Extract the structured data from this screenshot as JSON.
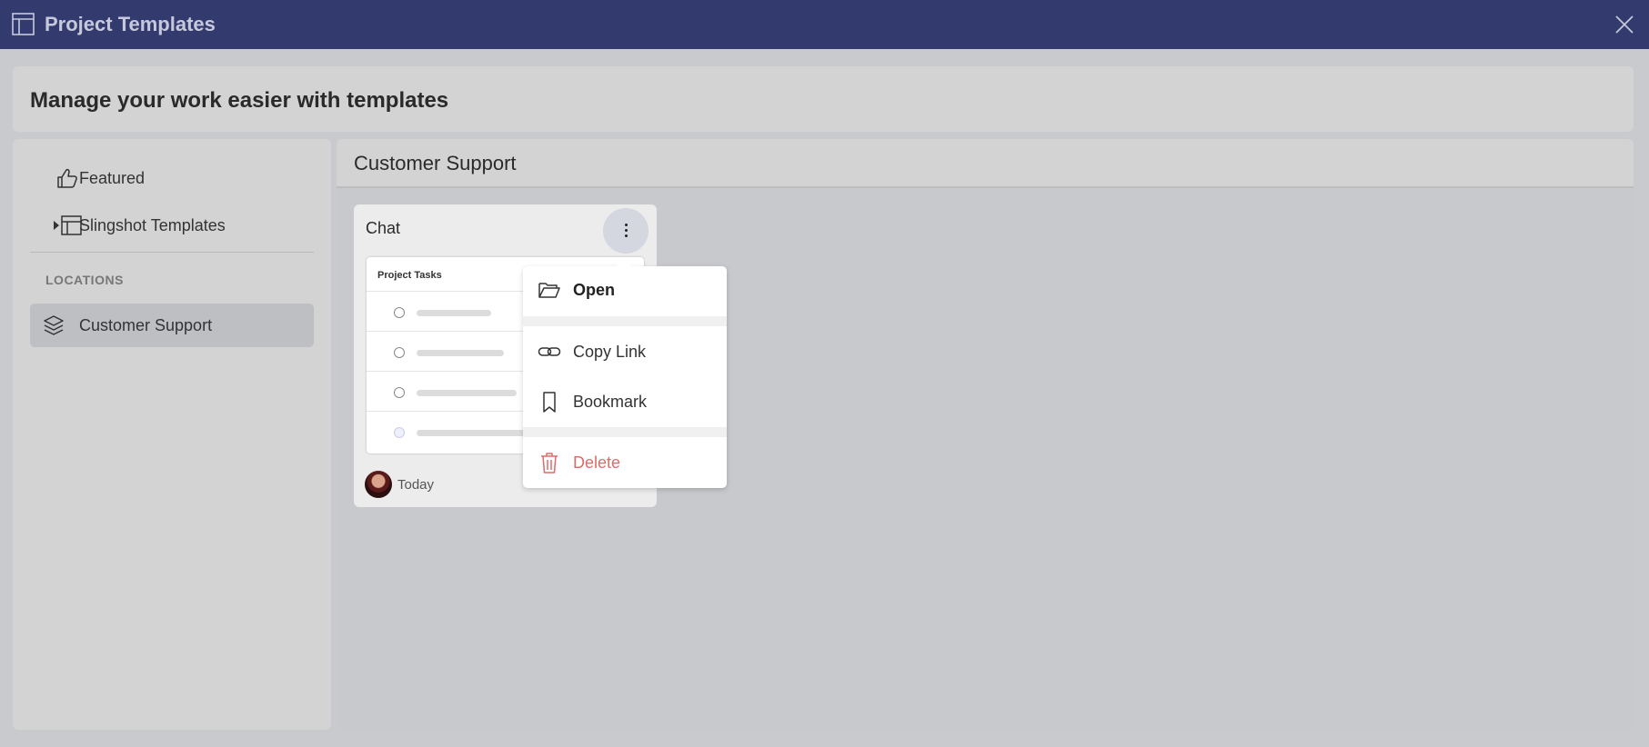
{
  "window": {
    "title": "Project Templates",
    "app_icon": "template-icon",
    "close_icon": "close-icon"
  },
  "banner": {
    "text": "Manage your work easier with templates"
  },
  "sidebar": {
    "items": [
      {
        "label": "Featured",
        "icon": "thumbs-up-icon"
      },
      {
        "label": "Slingshot Templates",
        "icon": "template-icon",
        "expandable": true
      }
    ],
    "locations_label": "LOCATIONS",
    "locations": [
      {
        "label": "Customer Support",
        "icon": "layers-icon",
        "selected": true
      }
    ]
  },
  "main": {
    "title": "Customer Support",
    "cards": [
      {
        "title": "Chat",
        "preview_title": "Project Tasks",
        "date": "Today",
        "menu_icon": "more-vertical-icon"
      }
    ]
  },
  "context_menu": {
    "items": [
      {
        "label": "Open",
        "icon": "folder-open-icon"
      },
      {
        "label": "Copy Link",
        "icon": "link-icon"
      },
      {
        "label": "Bookmark",
        "icon": "bookmark-icon"
      },
      {
        "label": "Delete",
        "icon": "trash-icon",
        "color": "#e06a6a"
      }
    ]
  },
  "colors": {
    "titlebar": "#333b6e",
    "accent_danger": "#e06a6a",
    "selected_item": "#bebfc3"
  }
}
